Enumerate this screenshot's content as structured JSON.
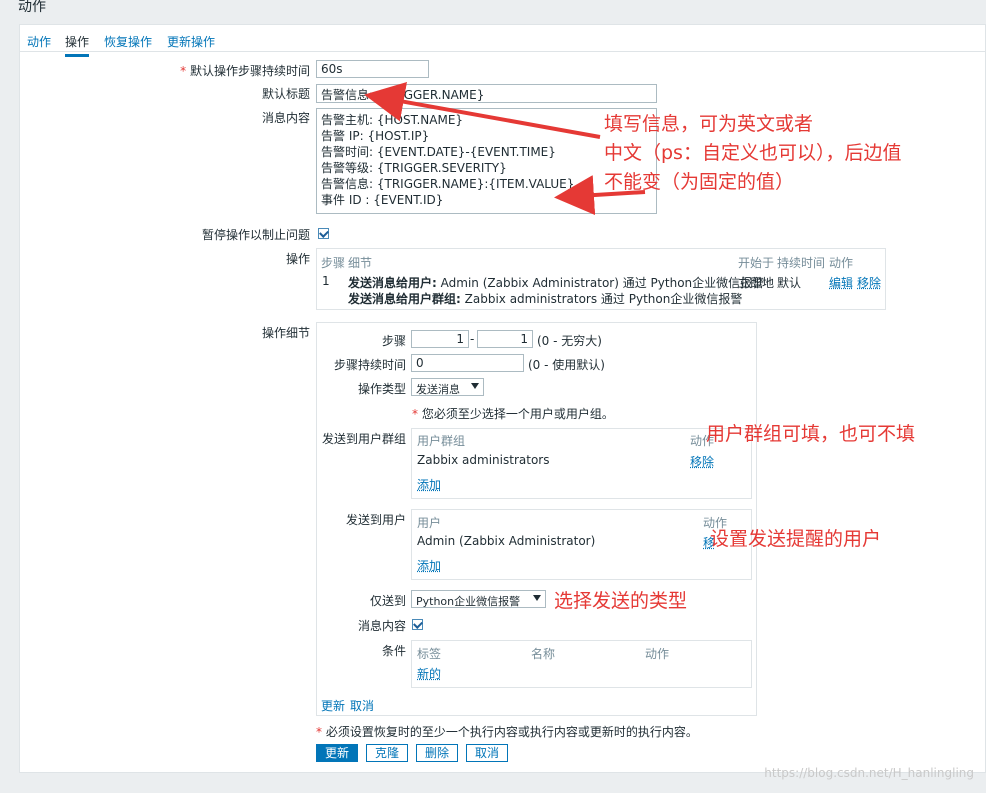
{
  "page_title": "动作",
  "tabs": [
    {
      "label": "动作"
    },
    {
      "label": "操作"
    },
    {
      "label": "恢复操作"
    },
    {
      "label": "更新操作"
    }
  ],
  "form": {
    "step_duration": {
      "label": "默认操作步骤持续时间",
      "value": "60s"
    },
    "subject": {
      "label": "默认标题",
      "value": "告警信息: {TRIGGER.NAME}"
    },
    "message": {
      "label": "消息内容",
      "lines": [
        "告警主机: {HOST.NAME}",
        "告警   IP: {HOST.IP}",
        "告警时间: {EVENT.DATE}-{EVENT.TIME}",
        "告警等级: {TRIGGER.SEVERITY}",
        "告警信息: {TRIGGER.NAME}:{ITEM.VALUE}",
        "事件  ID : {EVENT.ID}"
      ]
    },
    "pause_label": "暂停操作以制止问题"
  },
  "operations": {
    "label": "操作",
    "headers": {
      "steps": "步骤",
      "details": "细节",
      "start_in": "开始于",
      "duration": "持续时间",
      "action": "动作"
    },
    "row": {
      "step": "1",
      "line1_bold": "发送消息给用户:",
      "line1_text": "Admin (Zabbix Administrator) 通过 Python企业微信报警",
      "line2_bold": "发送消息给用户群组:",
      "line2_text": "Zabbix administrators 通过 Python企业微信报警",
      "start_in": "立即地",
      "duration": "默认",
      "edit": "编辑",
      "remove": "移除"
    }
  },
  "op_details": {
    "label": "操作细节",
    "steps": {
      "label": "步骤",
      "from": "1",
      "to": "1",
      "hint": "(0 - 无穷大)"
    },
    "step_duration": {
      "label": "步骤持续时间",
      "value": "0",
      "hint": "(0 - 使用默认)"
    },
    "op_type": {
      "label": "操作类型",
      "value": "发送消息"
    },
    "warning": "您必须至少选择一个用户或用户组。",
    "user_groups": {
      "label": "发送到用户群组",
      "col_group": "用户群组",
      "col_action": "动作",
      "item": "Zabbix administrators",
      "remove": "移除",
      "add": "添加"
    },
    "users": {
      "label": "发送到用户",
      "col_user": "用户",
      "col_action": "动作",
      "item": "Admin (Zabbix Administrator)",
      "remove": "移",
      "add": "添加"
    },
    "send_only": {
      "label": "仅送到",
      "value": "Python企业微信报警"
    },
    "default_message_label": "消息内容",
    "conditions": {
      "label": "条件",
      "col_label": "标签",
      "col_name": "名称",
      "col_action": "动作",
      "new": "新的"
    },
    "update": "更新",
    "cancel": "取消"
  },
  "footer_note": "必须设置恢复时的至少一个执行内容或执行内容或更新时的执行内容。",
  "buttons": {
    "update": "更新",
    "clone": "克隆",
    "delete": "删除",
    "cancel": "取消"
  },
  "annotations": {
    "fill_info_1": "填写信息，可为英文或者",
    "fill_info_2": "中文（ps：自定义也可以），后边值",
    "fill_info_3": "不能变（为固定的值）",
    "user_group": "用户群组可填，也可不填",
    "set_user": "设置发送提醒的用户",
    "select_type": "选择发送的类型"
  },
  "watermark": "https://blog.csdn.net/H_hanlingling"
}
